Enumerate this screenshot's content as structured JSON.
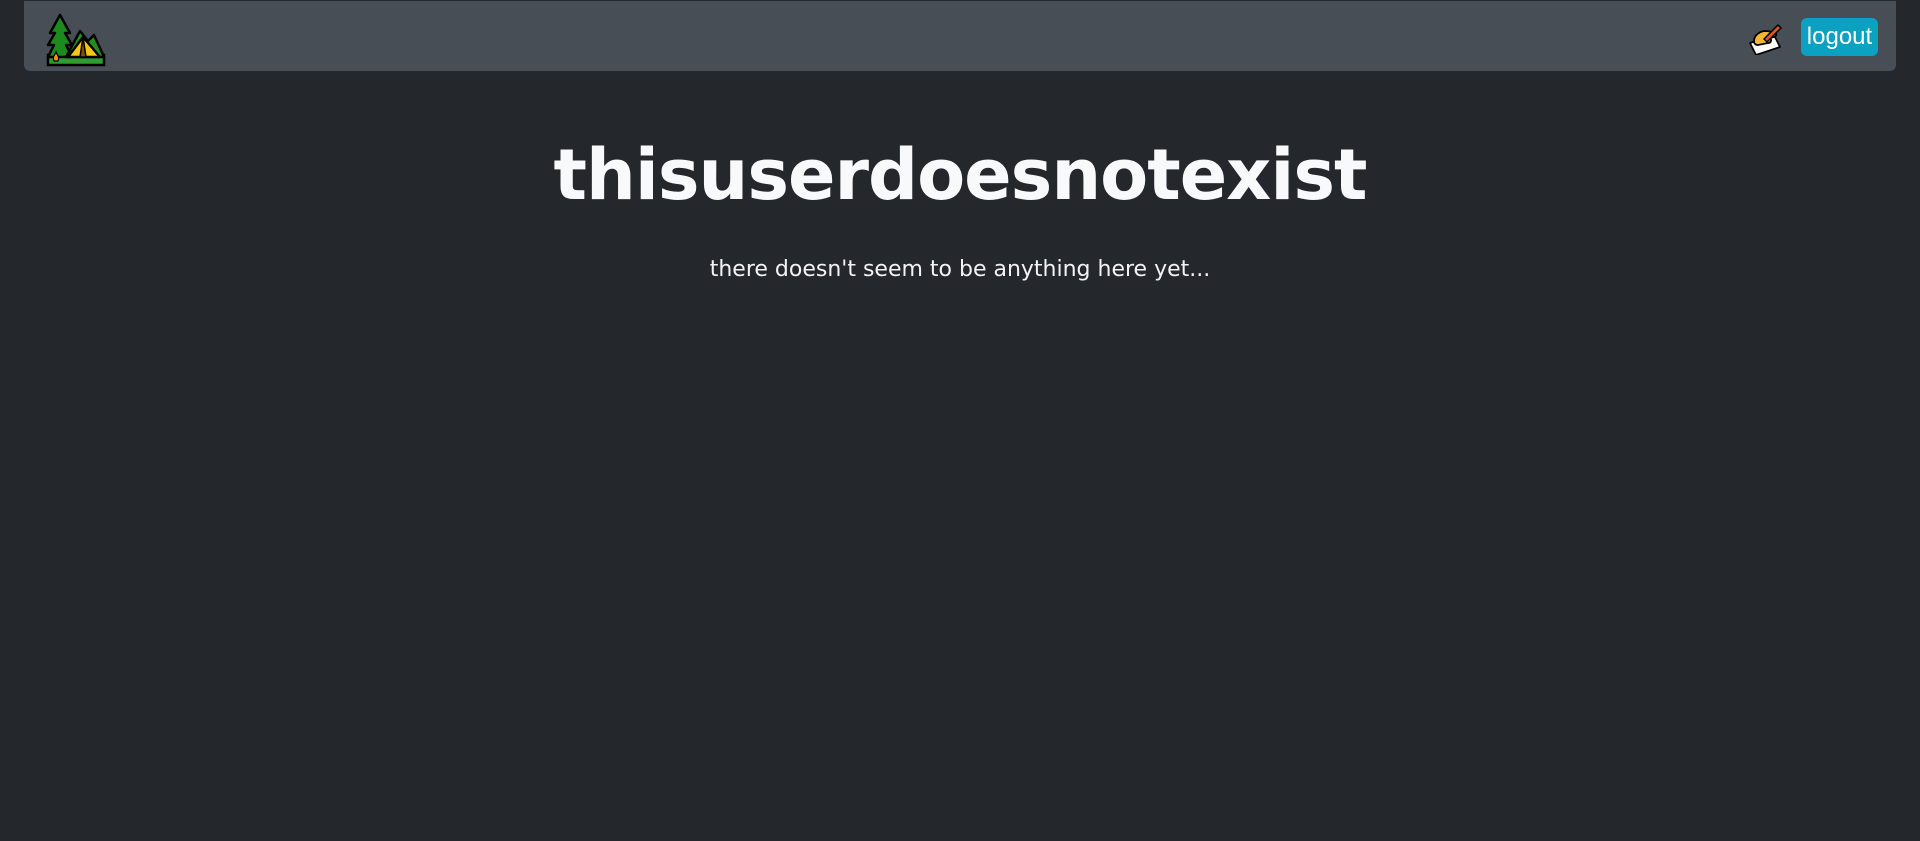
{
  "navbar": {
    "logo_icon": "camping-tent-icon",
    "write_icon": "writing-hand-icon",
    "logout_label": "logout",
    "logout_color": "#0aa2c0",
    "background_color": "#474e55"
  },
  "main": {
    "title": "thisuserdoesnotexist",
    "empty_message": "there doesn't seem to be anything here yet..."
  },
  "theme": {
    "page_background": "#24282c"
  }
}
